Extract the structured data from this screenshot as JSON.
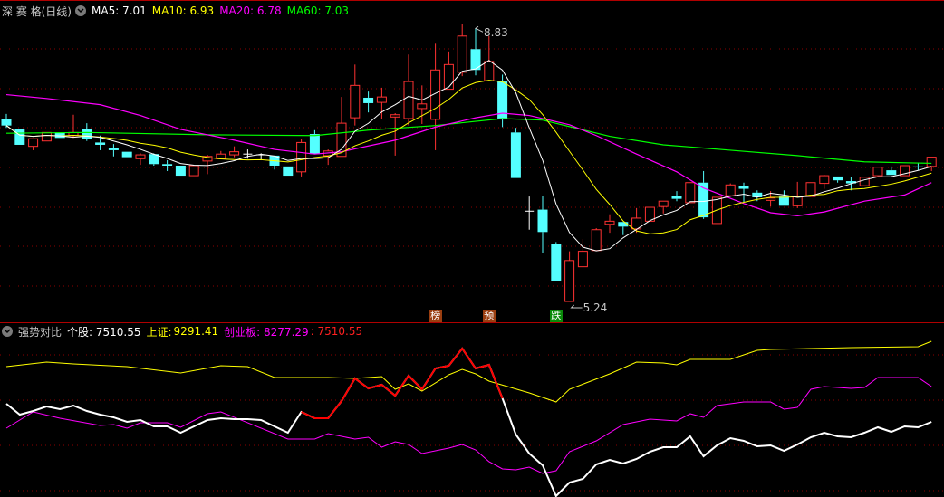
{
  "colors": {
    "up": "#ff3232",
    "down": "#54ffff",
    "ma5": "#ffffff",
    "ma10": "#ffff00",
    "ma20": "#ff00ff",
    "ma60": "#00ff00",
    "grid": "#8b0000",
    "tag_brown": "#9a3e10",
    "tag_green": "#0a8a0a"
  },
  "main_legend": {
    "title": "深 赛 格(日线)",
    "ma5": "MA5: 7.01",
    "ma10": "MA10: 6.93",
    "ma20": "MA20: 6.78",
    "ma60": "MA60: 7.03"
  },
  "sub_legend": {
    "title": "强势对比",
    "stock": "个股: 7510.55",
    "sh_label": "上证:",
    "sh_value": "9291.41",
    "cyb": "创业板: 8277.29",
    "extra": ": 7510.55"
  },
  "markers": [
    {
      "label": "榜",
      "index": 32,
      "style": "brown"
    },
    {
      "label": "预",
      "index": 36,
      "style": "brown"
    },
    {
      "label": "跌",
      "index": 41,
      "style": "green"
    }
  ],
  "chart_data": [
    {
      "type": "candlestick",
      "title": "深 赛 格(日线)",
      "ylim": [
        5.24,
        8.83
      ],
      "high_label": {
        "text": "8.83",
        "index": 35
      },
      "low_label": {
        "text": "5.24",
        "index": 42
      },
      "ohlc": [
        [
          7.6,
          7.67,
          7.49,
          7.52
        ],
        [
          7.48,
          7.48,
          7.27,
          7.27
        ],
        [
          7.25,
          7.35,
          7.2,
          7.35
        ],
        [
          7.32,
          7.43,
          7.32,
          7.43
        ],
        [
          7.43,
          7.43,
          7.36,
          7.36
        ],
        [
          7.39,
          7.66,
          7.36,
          7.43
        ],
        [
          7.48,
          7.55,
          7.32,
          7.34
        ],
        [
          7.3,
          7.39,
          7.2,
          7.27
        ],
        [
          7.23,
          7.28,
          7.12,
          7.2
        ],
        [
          7.18,
          7.18,
          7.11,
          7.11
        ],
        [
          7.09,
          7.16,
          7.01,
          7.14
        ],
        [
          7.15,
          7.16,
          7.0,
          7.02
        ],
        [
          7.02,
          7.07,
          6.93,
          7.0
        ],
        [
          7.0,
          7.0,
          6.87,
          6.87
        ],
        [
          6.87,
          7.0,
          6.87,
          7.0
        ],
        [
          7.06,
          7.14,
          6.89,
          7.12
        ],
        [
          7.09,
          7.19,
          7.09,
          7.15
        ],
        [
          7.14,
          7.25,
          7.11,
          7.18
        ],
        [
          7.15,
          7.21,
          7.09,
          7.15
        ],
        [
          7.14,
          7.16,
          7.07,
          7.14
        ],
        [
          7.13,
          7.13,
          6.95,
          7.0
        ],
        [
          6.99,
          6.99,
          6.87,
          6.87
        ],
        [
          6.92,
          7.34,
          6.86,
          7.3
        ],
        [
          7.41,
          7.46,
          7.15,
          7.15
        ],
        [
          7.13,
          7.21,
          7.01,
          7.19
        ],
        [
          7.12,
          7.89,
          7.12,
          7.55
        ],
        [
          7.62,
          8.31,
          7.52,
          8.04
        ],
        [
          7.88,
          7.96,
          7.69,
          7.81
        ],
        [
          7.82,
          8.01,
          7.61,
          7.89
        ],
        [
          7.63,
          7.68,
          7.13,
          7.66
        ],
        [
          7.61,
          8.44,
          7.52,
          8.09
        ],
        [
          7.74,
          8.04,
          7.54,
          7.8
        ],
        [
          7.6,
          8.58,
          7.2,
          8.24
        ],
        [
          7.99,
          8.48,
          7.99,
          8.31
        ],
        [
          8.21,
          8.83,
          8.16,
          8.68
        ],
        [
          8.51,
          8.78,
          8.17,
          8.24
        ],
        [
          8.1,
          8.68,
          8.1,
          8.35
        ],
        [
          8.09,
          8.18,
          7.5,
          7.61
        ],
        [
          7.43,
          7.49,
          6.84,
          6.84
        ],
        [
          6.41,
          6.6,
          6.17,
          6.41
        ],
        [
          6.43,
          6.61,
          5.87,
          6.14
        ],
        [
          5.98,
          6.01,
          5.51,
          5.51
        ],
        [
          5.24,
          5.89,
          5.24,
          5.77
        ],
        [
          5.69,
          6.05,
          5.69,
          5.89
        ],
        [
          5.9,
          6.19,
          5.9,
          6.17
        ],
        [
          6.24,
          6.37,
          6.13,
          6.28
        ],
        [
          6.27,
          6.27,
          6.1,
          6.21
        ],
        [
          6.18,
          6.45,
          6.13,
          6.32
        ],
        [
          6.28,
          6.46,
          6.28,
          6.46
        ],
        [
          6.47,
          6.54,
          6.38,
          6.54
        ],
        [
          6.61,
          6.67,
          6.54,
          6.57
        ],
        [
          6.52,
          6.78,
          6.52,
          6.78
        ],
        [
          6.78,
          6.93,
          6.31,
          6.33
        ],
        [
          6.25,
          6.59,
          6.25,
          6.59
        ],
        [
          6.61,
          6.77,
          6.61,
          6.75
        ],
        [
          6.74,
          6.78,
          6.53,
          6.7
        ],
        [
          6.65,
          6.68,
          6.54,
          6.59
        ],
        [
          6.55,
          6.67,
          6.47,
          6.58
        ],
        [
          6.6,
          6.68,
          6.48,
          6.48
        ],
        [
          6.48,
          6.79,
          6.45,
          6.6
        ],
        [
          6.6,
          6.78,
          6.6,
          6.78
        ],
        [
          6.77,
          6.88,
          6.7,
          6.87
        ],
        [
          6.86,
          6.86,
          6.78,
          6.81
        ],
        [
          6.8,
          6.85,
          6.68,
          6.77
        ],
        [
          6.74,
          6.85,
          6.74,
          6.85
        ],
        [
          6.87,
          6.98,
          6.87,
          6.98
        ],
        [
          6.94,
          6.99,
          6.88,
          6.88
        ],
        [
          6.87,
          7.0,
          6.87,
          7.0
        ],
        [
          6.99,
          7.04,
          6.94,
          6.98
        ],
        [
          6.99,
          7.11,
          6.93,
          7.11
        ]
      ],
      "ma20": [
        [
          0,
          7.92
        ],
        [
          3,
          7.87
        ],
        [
          7,
          7.79
        ],
        [
          10,
          7.65
        ],
        [
          13,
          7.47
        ],
        [
          17,
          7.33
        ],
        [
          20,
          7.21
        ],
        [
          23,
          7.15
        ],
        [
          25,
          7.18
        ],
        [
          29,
          7.33
        ],
        [
          32,
          7.5
        ],
        [
          35,
          7.62
        ],
        [
          37,
          7.68
        ],
        [
          39,
          7.65
        ],
        [
          42,
          7.53
        ],
        [
          44,
          7.39
        ],
        [
          47,
          7.15
        ],
        [
          50,
          6.92
        ],
        [
          52,
          6.71
        ],
        [
          55,
          6.51
        ],
        [
          57,
          6.39
        ],
        [
          59,
          6.35
        ],
        [
          61,
          6.4
        ],
        [
          64,
          6.54
        ],
        [
          67,
          6.62
        ],
        [
          69,
          6.78
        ]
      ],
      "ma60": [
        [
          0,
          7.42
        ],
        [
          6,
          7.43
        ],
        [
          15,
          7.4
        ],
        [
          23,
          7.39
        ],
        [
          27,
          7.46
        ],
        [
          32,
          7.52
        ],
        [
          37,
          7.61
        ],
        [
          40,
          7.59
        ],
        [
          45,
          7.38
        ],
        [
          49,
          7.27
        ],
        [
          54,
          7.2
        ],
        [
          59,
          7.13
        ],
        [
          64,
          7.05
        ],
        [
          69,
          7.03
        ]
      ]
    },
    {
      "type": "line",
      "title": "强势对比",
      "ylim": [
        0,
        3.4
      ],
      "series": [
        {
          "name": "上证",
          "color": "#ffff00",
          "points": [
            [
              0,
              2.74
            ],
            [
              3,
              2.84
            ],
            [
              5,
              2.8
            ],
            [
              9,
              2.74
            ],
            [
              13,
              2.6
            ],
            [
              16,
              2.76
            ],
            [
              18,
              2.74
            ],
            [
              20,
              2.5
            ],
            [
              24,
              2.5
            ],
            [
              26,
              2.48
            ],
            [
              28,
              2.52
            ],
            [
              29,
              2.24
            ],
            [
              30,
              2.36
            ],
            [
              31,
              2.2
            ],
            [
              33,
              2.56
            ],
            [
              34,
              2.68
            ],
            [
              35,
              2.58
            ],
            [
              36,
              2.42
            ],
            [
              39,
              2.16
            ],
            [
              41,
              1.96
            ],
            [
              42,
              2.24
            ],
            [
              45,
              2.58
            ],
            [
              47,
              2.84
            ],
            [
              49,
              2.82
            ],
            [
              50,
              2.78
            ],
            [
              51,
              2.9
            ],
            [
              54,
              2.9
            ],
            [
              56,
              3.1
            ],
            [
              57,
              3.12
            ],
            [
              60,
              3.14
            ],
            [
              63,
              3.16
            ],
            [
              68,
              3.18
            ],
            [
              69,
              3.3
            ]
          ]
        },
        {
          "name": "创业板",
          "color": "#ff00ff",
          "points": [
            [
              0,
              1.38
            ],
            [
              2,
              1.74
            ],
            [
              4,
              1.6
            ],
            [
              7,
              1.44
            ],
            [
              8,
              1.46
            ],
            [
              9,
              1.38
            ],
            [
              10,
              1.5
            ],
            [
              12,
              1.5
            ],
            [
              13,
              1.4
            ],
            [
              15,
              1.7
            ],
            [
              16,
              1.74
            ],
            [
              21,
              1.14
            ],
            [
              23,
              1.14
            ],
            [
              24,
              1.26
            ],
            [
              26,
              1.14
            ],
            [
              27,
              1.18
            ],
            [
              28,
              0.96
            ],
            [
              29,
              1.08
            ],
            [
              30,
              1.02
            ],
            [
              31,
              0.82
            ],
            [
              33,
              0.94
            ],
            [
              34,
              1.02
            ],
            [
              35,
              0.9
            ],
            [
              36,
              0.64
            ],
            [
              37,
              0.48
            ],
            [
              38,
              0.46
            ],
            [
              39,
              0.52
            ],
            [
              40,
              0.38
            ],
            [
              41,
              0.44
            ],
            [
              42,
              0.86
            ],
            [
              44,
              1.1
            ],
            [
              46,
              1.46
            ],
            [
              48,
              1.58
            ],
            [
              50,
              1.54
            ],
            [
              51,
              1.7
            ],
            [
              52,
              1.62
            ],
            [
              53,
              1.88
            ],
            [
              55,
              1.96
            ],
            [
              57,
              1.96
            ],
            [
              58,
              1.8
            ],
            [
              59,
              1.84
            ],
            [
              60,
              2.24
            ],
            [
              61,
              2.3
            ],
            [
              63,
              2.26
            ],
            [
              64,
              2.28
            ],
            [
              65,
              2.5
            ],
            [
              68,
              2.5
            ],
            [
              69,
              2.3
            ]
          ]
        },
        {
          "name": "个股",
          "color": "#ffffff",
          "strong_color": "#ff0000",
          "strong_range": [
            22,
            37
          ],
          "values": [
            1.92,
            1.68,
            1.76,
            1.86,
            1.8,
            1.88,
            1.76,
            1.68,
            1.62,
            1.52,
            1.56,
            1.42,
            1.42,
            1.28,
            1.42,
            1.56,
            1.6,
            1.58,
            1.58,
            1.56,
            1.42,
            1.28,
            1.74,
            1.6,
            1.6,
            1.98,
            2.48,
            2.26,
            2.34,
            2.1,
            2.54,
            2.24,
            2.7,
            2.76,
            3.14,
            2.7,
            2.78,
            2.04,
            1.24,
            0.82,
            0.56,
            -0.12,
            0.18,
            0.26,
            0.58,
            0.68,
            0.6,
            0.7,
            0.86,
            0.96,
            0.96,
            1.2,
            0.76,
            1.0,
            1.16,
            1.1,
            0.98,
            1.0,
            0.88,
            1.02,
            1.18,
            1.28,
            1.2,
            1.18,
            1.28,
            1.4,
            1.3,
            1.42,
            1.4,
            1.52
          ]
        }
      ]
    }
  ]
}
